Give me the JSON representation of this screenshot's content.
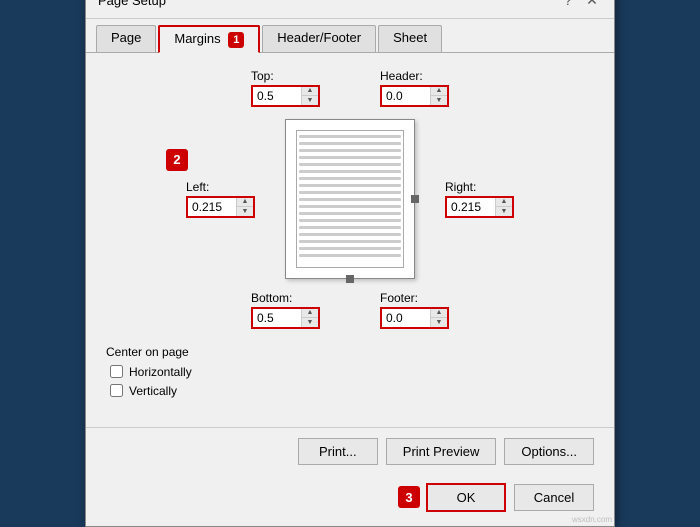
{
  "dialog": {
    "title": "Page Setup",
    "tabs": [
      {
        "id": "page",
        "label": "Page",
        "active": false
      },
      {
        "id": "margins",
        "label": "Margins",
        "active": true
      },
      {
        "id": "headerfooter",
        "label": "Header/Footer",
        "active": false
      },
      {
        "id": "sheet",
        "label": "Sheet",
        "active": false
      }
    ]
  },
  "margins": {
    "top_label": "Top:",
    "top_value": "0.5",
    "bottom_label": "Bottom:",
    "bottom_value": "0.5",
    "left_label": "Left:",
    "left_value": "0.215",
    "right_label": "Right:",
    "right_value": "0.215",
    "header_label": "Header:",
    "header_value": "0.0",
    "footer_label": "Footer:",
    "footer_value": "0.0"
  },
  "center_on_page": {
    "title": "Center on page",
    "horizontally_label": "Horizontally",
    "vertically_label": "Vertically"
  },
  "buttons": {
    "print": "Print...",
    "print_preview": "Print Preview",
    "options": "Options...",
    "ok": "OK",
    "cancel": "Cancel"
  },
  "annotations": {
    "badge1": "1",
    "badge2": "2",
    "badge3": "3"
  },
  "title_btns": {
    "help": "?",
    "close": "✕"
  }
}
